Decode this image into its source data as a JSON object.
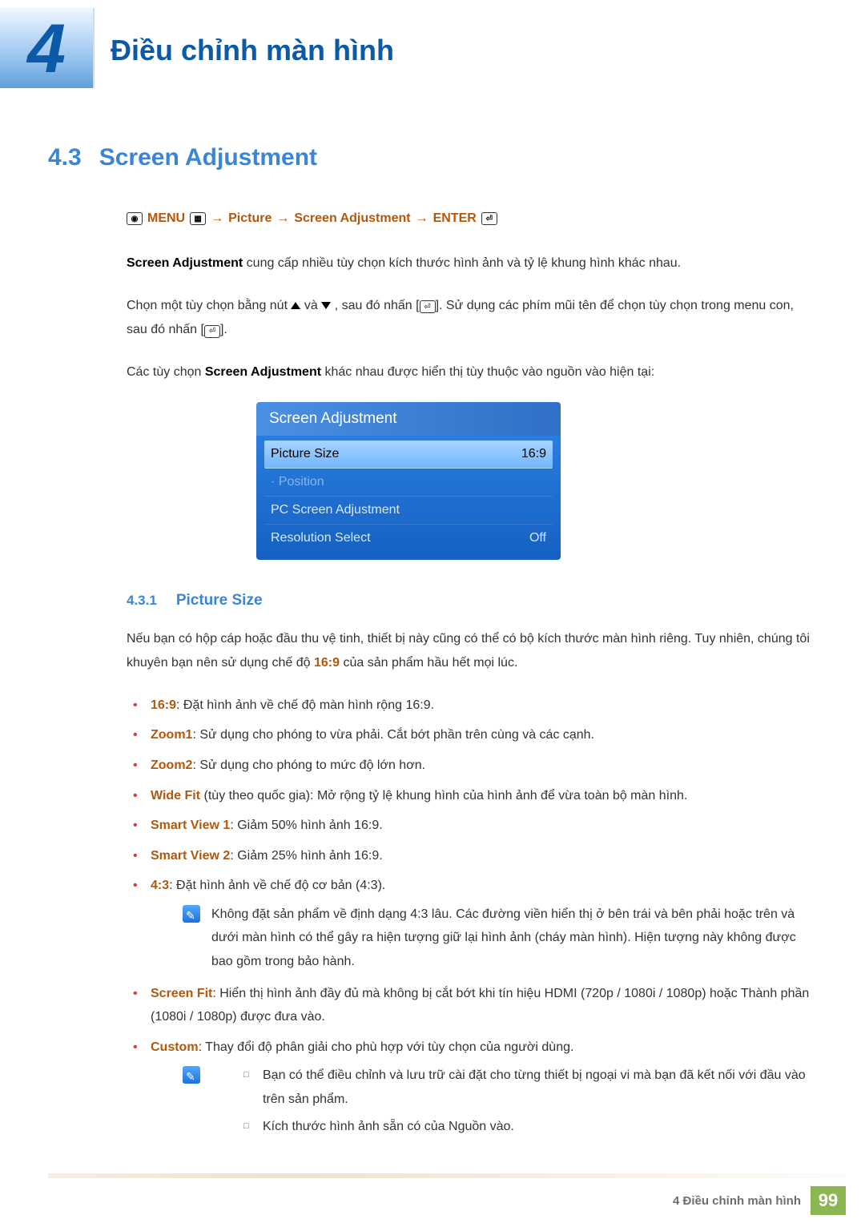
{
  "chapter": {
    "num": "4",
    "title": "Điều chỉnh màn hình"
  },
  "section": {
    "num": "4.3",
    "title": "Screen Adjustment"
  },
  "nav": {
    "menu": "MENU",
    "p1": "Picture",
    "p2": "Screen Adjustment",
    "enter": "ENTER",
    "arrow": "→"
  },
  "para1_a": "Screen Adjustment",
  "para1_b": " cung cấp nhiều tùy chọn kích thước hình ảnh và tỷ lệ khung hình khác nhau.",
  "para2_a": "Chọn một tùy chọn bằng nút ",
  "para2_b": " và ",
  "para2_c": ", sau đó nhấn [",
  "para2_d": "]. Sử dụng các phím mũi tên để chọn tùy chọn trong menu con, sau đó nhấn [",
  "para2_e": "].",
  "para3_a": "Các tùy chọn ",
  "para3_b": "Screen Adjustment",
  "para3_c": " khác nhau được hiển thị tùy thuộc vào nguồn vào hiện tại:",
  "osd": {
    "title": "Screen Adjustment",
    "rows": [
      {
        "label": "Picture Size",
        "value": "16:9",
        "highlight": true
      },
      {
        "label": "· Position",
        "value": "",
        "disabled": true
      },
      {
        "label": "PC Screen Adjustment",
        "value": ""
      },
      {
        "label": "Resolution Select",
        "value": "Off"
      }
    ]
  },
  "subsec": {
    "num": "4.3.1",
    "title": "Picture Size"
  },
  "ps_intro_a": "Nếu bạn có hộp cáp hoặc đầu thu vệ tinh, thiết bị này cũng có thể có bộ kích thước màn hình riêng. Tuy nhiên, chúng tôi khuyên bạn nên sử dụng chế độ ",
  "ps_intro_b": "16:9",
  "ps_intro_c": " của sản phẩm hầu hết mọi lúc.",
  "opts": [
    {
      "k": "16:9",
      "t": ": Đặt hình ảnh về chế độ màn hình rộng 16:9."
    },
    {
      "k": "Zoom1",
      "t": ": Sử dụng cho phóng to vừa phải. Cắt bớt phần trên cùng và các cạnh."
    },
    {
      "k": "Zoom2",
      "t": ": Sử dụng cho phóng to mức độ lớn hơn."
    },
    {
      "k": "Wide Fit",
      "t": " (tùy theo quốc gia): Mở rộng tỷ lệ khung hình của hình ảnh để vừa toàn bộ màn hình."
    },
    {
      "k": "Smart View 1",
      "t": ": Giảm 50% hình ảnh 16:9."
    },
    {
      "k": "Smart View 2",
      "t": ": Giảm 25% hình ảnh 16:9."
    },
    {
      "k": "4:3",
      "t": ": Đặt hình ảnh về chế độ cơ bản (4:3)."
    }
  ],
  "note43": "Không đặt sản phẩm về định dạng 4:3 lâu. Các đường viền hiển thị ở bên trái và bên phải hoặc trên và dưới màn hình có thể gây ra hiện tượng giữ lại hình ảnh (cháy màn hình). Hiện tượng này không được bao gồm trong bảo hành.",
  "opt_screenfit_k": "Screen Fit",
  "opt_screenfit_t": ": Hiển thị hình ảnh đầy đủ mà không bị cắt bớt khi tín hiệu HDMI (720p / 1080i / 1080p) hoặc Thành phần (1080i / 1080p) được đưa vào.",
  "opt_custom_k": "Custom",
  "opt_custom_t": ": Thay đổi độ phân giải cho phù hợp với tùy chọn của người dùng.",
  "note_custom": [
    "Bạn có thể điều chỉnh và lưu trữ cài đặt cho từng thiết bị ngoại vi mà bạn đã kết nối với đầu vào trên sản phẩm.",
    "Kích thước hình ảnh sẵn có của Nguồn vào."
  ],
  "footer": {
    "text": "4 Điều chỉnh màn hình",
    "page": "99"
  }
}
